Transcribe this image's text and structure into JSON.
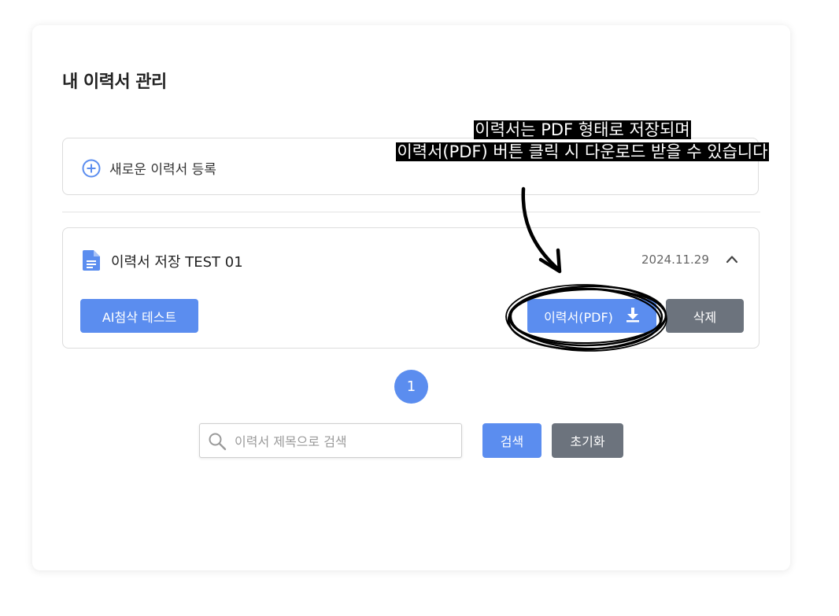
{
  "page": {
    "title": "내 이력서 관리"
  },
  "new_resume": {
    "label": "새로운 이력서 등록",
    "icon": "plus-circle-icon"
  },
  "resume_item": {
    "title": "이력서 저장 TEST 01",
    "date": "2024.11.29",
    "ai_button": "AI첨삭 테스트",
    "pdf_button": "이력서(PDF)",
    "delete_button": "삭제",
    "icons": {
      "doc": "document-icon",
      "toggle": "chevron-up-icon",
      "download": "download-icon"
    }
  },
  "annotation": {
    "line1": "이력서는 PDF 형태로 저장되며",
    "line2": "이력서(PDF) 버튼 클릭 시 다운로드 받을 수 있습니다"
  },
  "pagination": {
    "current": "1"
  },
  "search": {
    "placeholder": "이력서 제목으로 검색",
    "value": "",
    "search_button": "검색",
    "reset_button": "초기화"
  },
  "colors": {
    "primary": "#5b8def",
    "secondary": "#6c737d"
  }
}
